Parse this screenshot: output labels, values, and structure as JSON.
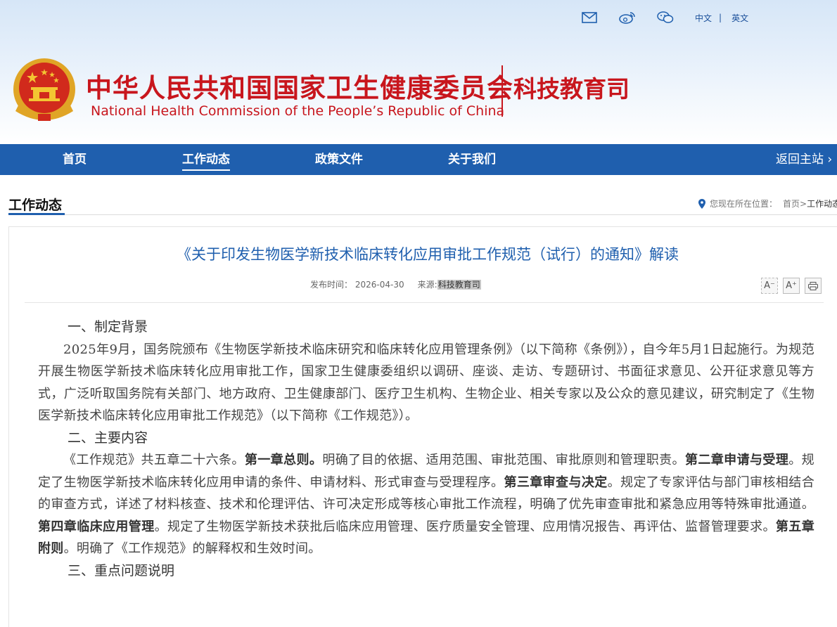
{
  "header": {
    "title_cn": "中华人民共和国国家卫生健康委员会",
    "title_en": "National Health Commission of the People’s  Republic of China",
    "department": "科技教育司",
    "lang_cn": "中文",
    "lang_sep": "|",
    "lang_en": "英文",
    "icons": [
      "mail-icon",
      "weibo-icon",
      "wechat-icon"
    ],
    "accent_color": "#c8161d"
  },
  "nav": {
    "items": [
      {
        "label": "首页"
      },
      {
        "label": "工作动态"
      },
      {
        "label": "政策文件"
      },
      {
        "label": "关于我们"
      }
    ],
    "active": "工作动态",
    "return_label": "返回主站",
    "return_arrow": "›",
    "bar_color": "#1f5fae"
  },
  "section": {
    "title": "工作动态",
    "location_label": "您现在所在位置：",
    "location_home": "首页",
    "location_arrow": ">",
    "location_current": "工作动态"
  },
  "article": {
    "title": "《关于印发生物医学新技术临床转化应用审批工作规范（试行）的通知》解读",
    "date_label": "发布时间：",
    "date": "2026-04-30",
    "source_label": "来源:",
    "source": "科技教育司",
    "font_small": "A⁻",
    "font_large": "A⁺",
    "heading_1": "一、制定背景",
    "para_1": "2025年9月，国务院颁布《生物医学新技术临床研究和临床转化应用管理条例》（以下简称《条例》），自今年5月1日起施行。为规范开展生物医学新技术临床转化应用审批工作，国家卫生健康委组织以调研、座谈、走访、专题研讨、书面征求意见、公开征求意见等方式，广泛听取国务院有关部门、地方政府、卫生健康部门、医疗卫生机构、生物企业、相关专家以及公众的意见建议，研究制定了《生物医学新技术临床转化应用审批工作规范》（以下简称《工作规范》）。",
    "heading_2": "二、主要内容",
    "para_2": {
      "intro": "《工作规范》共五章二十六条。",
      "ch1_title": "第一章总则。",
      "ch1_text": "明确了目的依据、适用范围、审批范围、审批原则和管理职责。",
      "ch2_title": "第二章申请与受理",
      "ch2_text": "。规定了生物医学新技术临床转化应用申请的条件、申请材料、形式审查与受理程序。",
      "ch3_title": "第三章审查与决定",
      "ch3_text": "。规定了专家评估与部门审核相结合的审查方式，详述了材料核查、技术和伦理评估、许可决定形成等核心审批工作流程，明确了优先审查审批和紧急应用等特殊审批通道。",
      "ch4_title": "第四章临床应用管理",
      "ch4_text": "。规定了生物医学新技术获批后临床应用管理、医疗质量安全管理、应用情况报告、再评估、监督管理要求。",
      "ch5_title": "第五章附则",
      "ch5_text": "。明确了《工作规范》的解释权和生效时间。"
    },
    "heading_3": "三、重点问题说明"
  }
}
